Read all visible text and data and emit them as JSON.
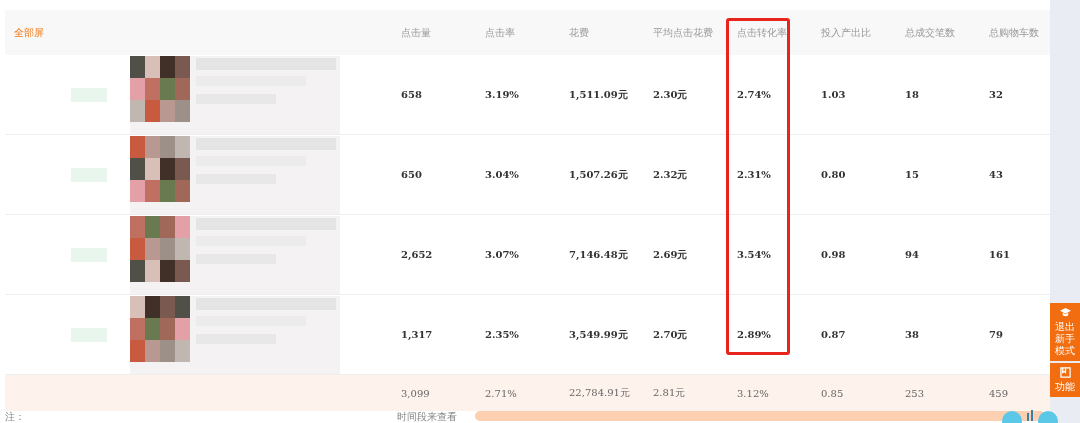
{
  "table": {
    "filter_label": "全部屏",
    "columns": [
      {
        "label": "点击量",
        "highlighted": false
      },
      {
        "label": "点击率",
        "highlighted": false
      },
      {
        "label": "花费",
        "highlighted": false
      },
      {
        "label": "平均点击花费",
        "highlighted": false
      },
      {
        "label": "点击转化率",
        "highlighted": true
      },
      {
        "label": "投入产出比",
        "highlighted": false
      },
      {
        "label": "总成交笔数",
        "highlighted": false
      },
      {
        "label": "总购物车数",
        "highlighted": false
      }
    ],
    "rows": [
      {
        "values": [
          "658",
          "3.19%",
          "1,511.09元",
          "2.30元",
          "2.74%",
          "1.03",
          "18",
          "32"
        ]
      },
      {
        "values": [
          "650",
          "3.04%",
          "1,507.26元",
          "2.32元",
          "2.31%",
          "0.80",
          "15",
          "43"
        ]
      },
      {
        "values": [
          "2,652",
          "3.07%",
          "7,146.48元",
          "2.69元",
          "3.54%",
          "0.98",
          "94",
          "161"
        ]
      },
      {
        "values": [
          "1,317",
          "2.35%",
          "3,549.99元",
          "2.70元",
          "2.89%",
          "0.87",
          "38",
          "79"
        ]
      }
    ],
    "total_row": [
      "3,099",
      "2.71%",
      "22,784.91元",
      "2.81元",
      "3.12%",
      "0.85",
      "253",
      "459"
    ]
  },
  "note": {
    "prefix": "注：",
    "suffix": "时间段来查看"
  },
  "side_panel": [
    {
      "kind": "cap",
      "label": "退出新手模式"
    },
    {
      "kind": "book",
      "label": "功能"
    }
  ]
}
